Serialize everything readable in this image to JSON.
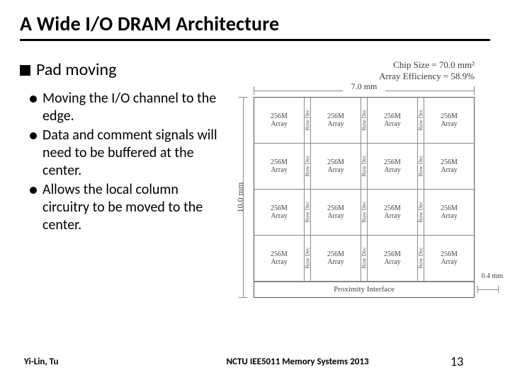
{
  "title": "A Wide I/O DRAM Architecture",
  "section_heading": "Pad moving",
  "bullets": [
    "Moving the I/O channel to the edge.",
    "Data and comment signals will need to be buffered at the center.",
    "Allows the local column circuitry to be moved to the center."
  ],
  "chip_meta": {
    "size_line": "Chip Size = 70.0 mm²",
    "eff_line": "Array Efficiency = 58.9%"
  },
  "dimensions": {
    "width_label": "7.0 mm",
    "height_label": "10.0 mm",
    "prox_gap_label": "0.4 mm"
  },
  "cell_label_top": "256M",
  "cell_label_bottom": "Array",
  "row_dec_label": "Row Dec",
  "proximity_label": "Proximity Interface",
  "footer": {
    "author": "Yi-Lin, Tu",
    "course": "NCTU IEE5011 Memory Systems 2013",
    "page": "13"
  },
  "chart_data": {
    "type": "table",
    "title": "Wide I/O DRAM chip floorplan",
    "grid_rows": 4,
    "grid_cols": 4,
    "cell_capacity_mbit": 256,
    "row_decoder_between_columns": true,
    "chip_width_mm": 7.0,
    "chip_height_mm": 10.0,
    "proximity_interface_height_mm": 0.4,
    "chip_area_mm2": 70.0,
    "array_efficiency_pct": 58.9
  }
}
